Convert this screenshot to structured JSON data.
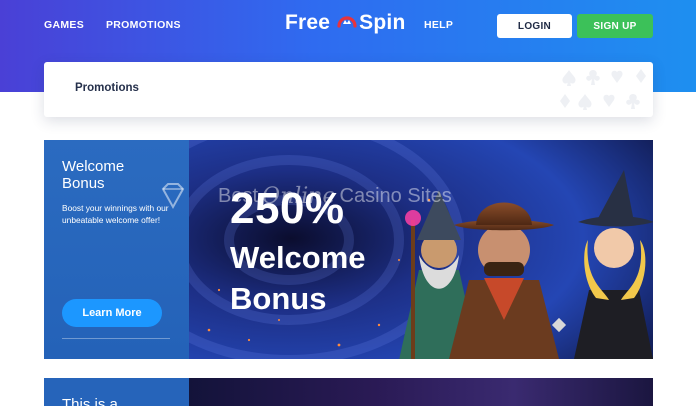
{
  "nav": {
    "games": "GAMES",
    "promotions": "PROMOTIONS",
    "help": "HELP",
    "login": "LOGIN",
    "signup": "SIGN UP"
  },
  "logo": {
    "left": "Free",
    "right": "Spin"
  },
  "page_header": {
    "title": "Promotions"
  },
  "welcome_promo": {
    "title_line1": "Welcome",
    "title_line2": "Bonus",
    "description": "Boost your winnings with our unbeatable welcome offer!",
    "cta": "Learn More",
    "art_line1": "250%",
    "art_line2": "Welcome",
    "art_line3": "Bonus"
  },
  "watermark": {
    "part1": "Best",
    "part2": "Online",
    "part3": "Casino Sites"
  },
  "next_promo": {
    "title_partial": "This is a"
  },
  "colors": {
    "header_gradient_start": "#4a40d6",
    "header_gradient_end": "#1e8ff0",
    "signup_green": "#3cc159",
    "cta_blue": "#1c97ff",
    "side_panel_blue": "#2b6bc0"
  }
}
